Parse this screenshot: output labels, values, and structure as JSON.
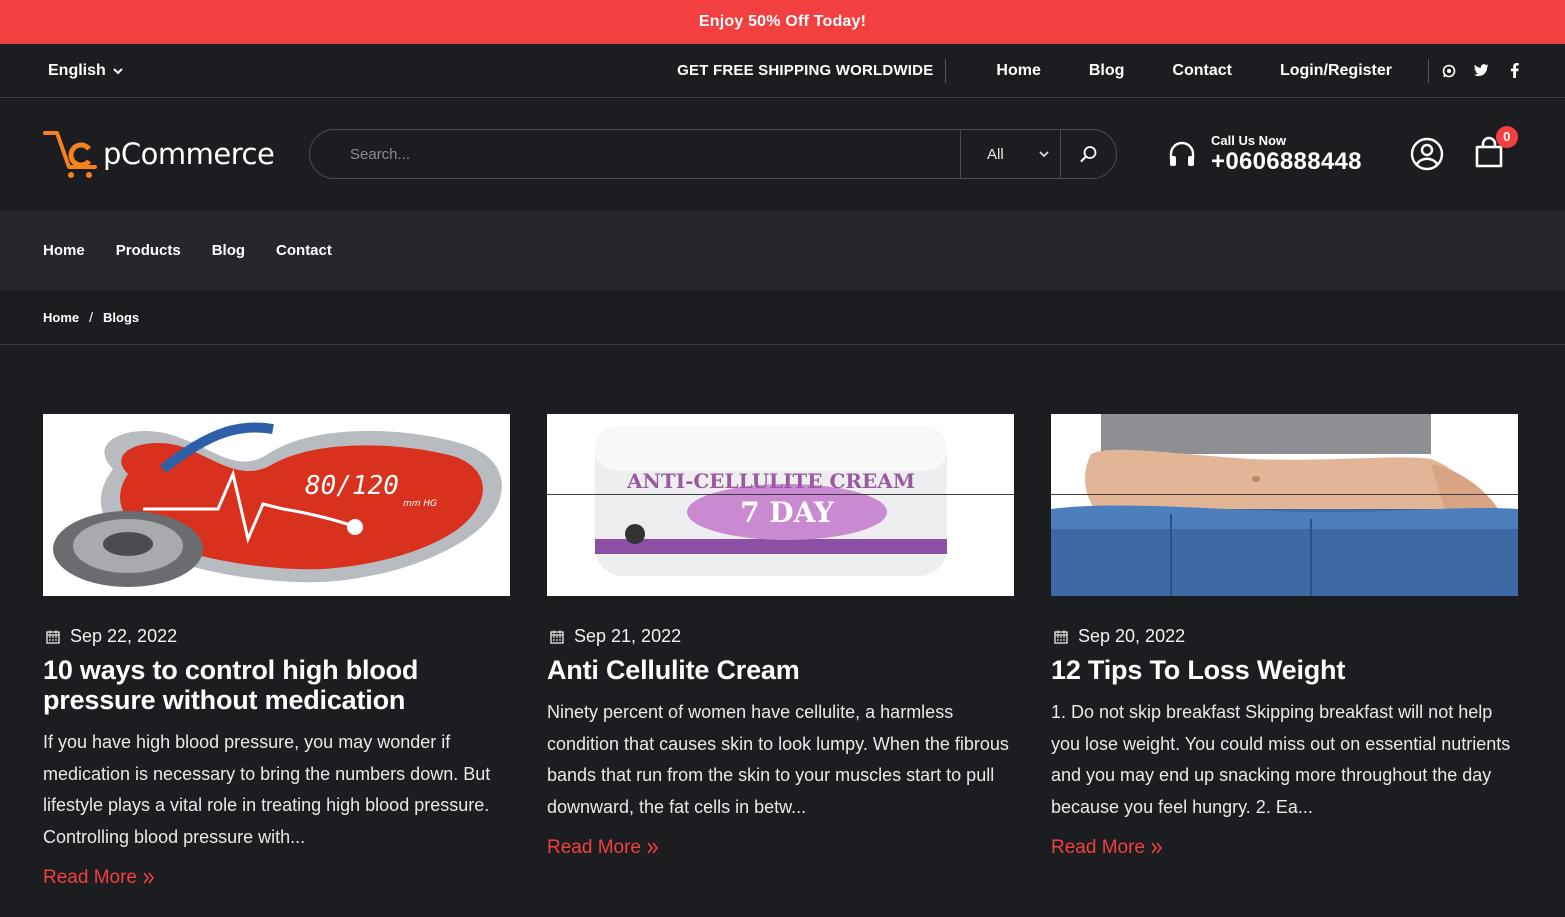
{
  "promo": {
    "text": "Enjoy 50% Off Today!"
  },
  "topbar": {
    "language": "English",
    "shipping": "GET FREE SHIPPING WORLDWIDE",
    "links": [
      "Home",
      "Blog",
      "Contact",
      "Login/Register"
    ],
    "socials": [
      "whatsapp-icon",
      "twitter-icon",
      "facebook-icon"
    ]
  },
  "header": {
    "logo_text": "pCommerce",
    "search_placeholder": "Search...",
    "category": "All",
    "call_label": "Call Us Now",
    "call_number": "+0606888448",
    "cart_count": "0"
  },
  "nav": {
    "items": [
      "Home",
      "Products",
      "Blog",
      "Contact"
    ]
  },
  "breadcrumb": {
    "home": "Home",
    "separator": "/",
    "current": "Blogs"
  },
  "posts": [
    {
      "date": "Sep 22, 2022",
      "title": "10 ways to control high blood pressure without medication",
      "excerpt": "If you have high blood pressure, you may wonder if medication is necessary to bring the numbers down. But lifestyle plays a vital role in treating high blood pressure. Controlling blood pressure with...",
      "read_more": "Read More",
      "image_label": "80/120",
      "image_unit": "mm HG"
    },
    {
      "date": "Sep 21, 2022",
      "title": "Anti Cellulite Cream",
      "excerpt": "Ninety percent of women have cellulite, a harmless condition that causes skin to look lumpy. When the fibrous bands that run from the skin to your muscles start to pull downward, the fat cells in betw...",
      "read_more": "Read More",
      "image_label": "ANTI-CELLULITE CREAM",
      "image_sub": "7 DAY"
    },
    {
      "date": "Sep 20, 2022",
      "title": "12 Tips To Loss Weight",
      "excerpt": "1. Do not skip breakfast Skipping breakfast will not help you lose weight. You could miss out on essential nutrients and you may end up snacking more throughout the day because you feel hungry.  2. Ea...",
      "read_more": "Read More"
    }
  ],
  "colors": {
    "accent": "#f23f3f",
    "background": "#1c1d21",
    "nav_bg": "#25272d",
    "logo_orange": "#f58220"
  }
}
